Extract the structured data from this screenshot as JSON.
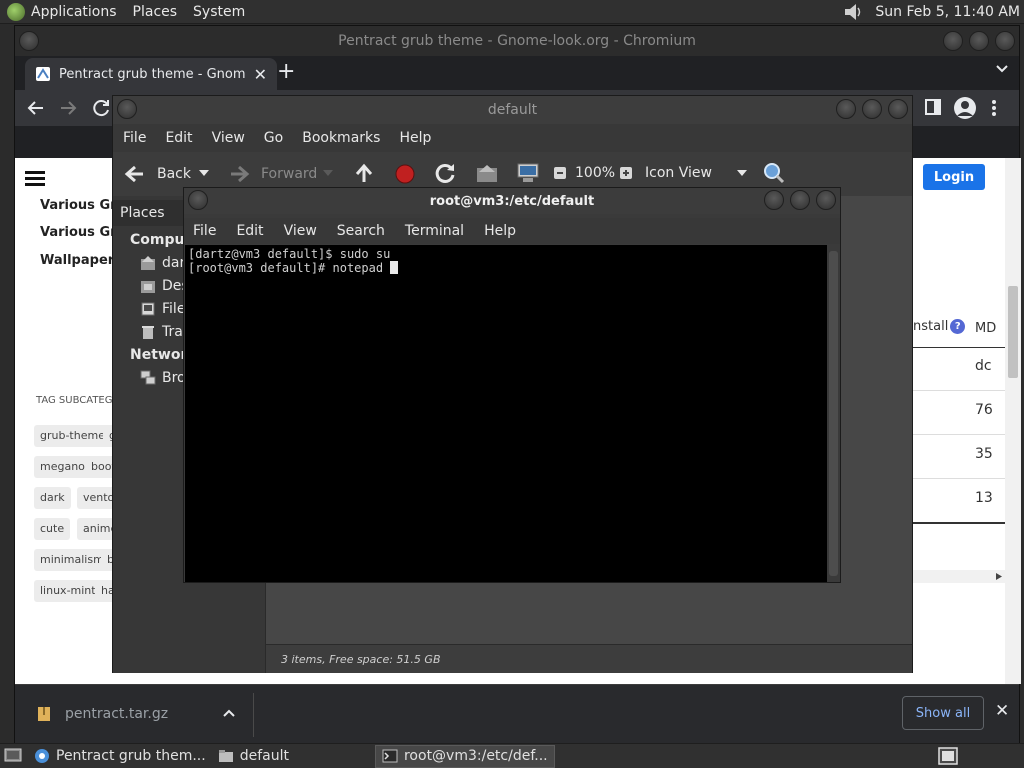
{
  "top_panel": {
    "menus": [
      "Applications",
      "Places",
      "System"
    ],
    "clock": "Sun Feb  5, 11:40 AM"
  },
  "chromium": {
    "window_title": "Pentract grub theme - Gnome-look.org - Chromium",
    "tab_title": "Pentract grub theme - Gnome",
    "login_label": "Login",
    "sidebar_links": [
      "Various Gnor",
      "Various Gnor",
      "Wallpapers G"
    ],
    "tag_section_title": "TAG SUBCATEGO",
    "tags": [
      [
        "grub-theme",
        "g"
      ],
      [
        "megano",
        "boot"
      ],
      [
        "dark",
        "ventoy"
      ],
      [
        "cute",
        "anime"
      ],
      [
        "minimalism",
        "b"
      ],
      [
        "linux-mint",
        "ha"
      ]
    ],
    "install_label": "nstall",
    "md_label": "MD",
    "table_values": [
      "dc",
      "76",
      "35",
      "13"
    ],
    "download_filename": "pentract.tar.gz",
    "show_all_label": "Show all"
  },
  "nautilus": {
    "title": "default",
    "menu": [
      "File",
      "Edit",
      "View",
      "Go",
      "Bookmarks",
      "Help"
    ],
    "toolbar": {
      "back": "Back",
      "forward": "Forward",
      "zoom": "100%",
      "view_mode": "Icon View"
    },
    "places_label": "Places",
    "sidebar": {
      "computer_header": "Compute",
      "items": [
        "dar",
        "Des",
        "File",
        "Tra"
      ],
      "network_header": "Network",
      "network_items": [
        "Bro"
      ]
    },
    "status": "3 items, Free space: 51.5 GB"
  },
  "terminal": {
    "title": "root@vm3:/etc/default",
    "menu": [
      "File",
      "Edit",
      "View",
      "Search",
      "Terminal",
      "Help"
    ],
    "lines": [
      "[dartz@vm3 default]$ sudo su",
      "[root@vm3 default]# notepad "
    ]
  },
  "taskbar": {
    "tasks": [
      "Pentract grub them...",
      "default",
      "root@vm3:/etc/def..."
    ]
  },
  "colors": {
    "chrome_accent": "#1a73e8",
    "terminal_bg": "#000000",
    "panel_bg": "#303030"
  }
}
